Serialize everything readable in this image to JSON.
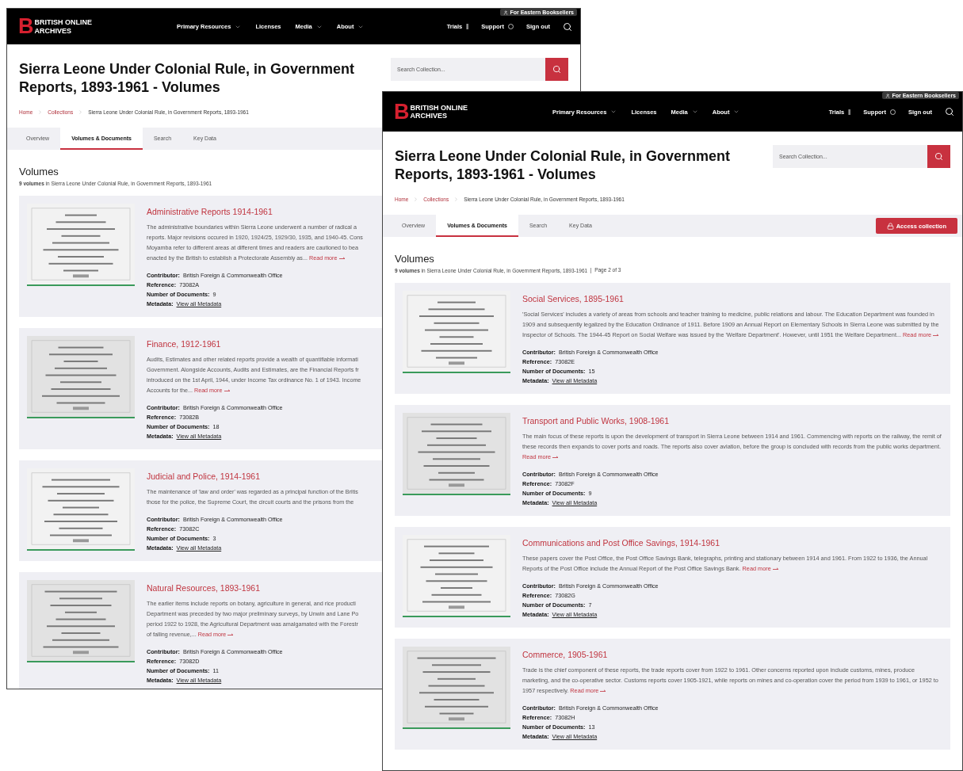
{
  "windows": [
    {
      "badge": "For Eastern Booksellers",
      "logo": {
        "mark": "B",
        "line1": "BRITISH ONLINE",
        "line2": "ARCHIVES"
      },
      "nav": [
        {
          "label": "Primary Resources",
          "dropdown": true
        },
        {
          "label": "Licenses",
          "dropdown": false
        },
        {
          "label": "Media",
          "dropdown": true
        },
        {
          "label": "About",
          "dropdown": true
        }
      ],
      "user_links": [
        {
          "label": "Trials",
          "kind": "trials"
        },
        {
          "label": "Support",
          "kind": "support"
        },
        {
          "label": "Sign out",
          "kind": "plain"
        }
      ],
      "title": "Sierra Leone Under Colonial Rule, in Government Reports, 1893-1961 - Volumes",
      "search": {
        "placeholder": "Search Collection..."
      },
      "breadcrumb": [
        "Home",
        "Collections",
        "Sierra Leone Under Colonial Rule, in Government Reports, 1893-1961"
      ],
      "tabs": [
        {
          "label": "Overview",
          "selected": false
        },
        {
          "label": "Volumes & Documents",
          "selected": true
        },
        {
          "label": "Search",
          "selected": false
        },
        {
          "label": "Key Data",
          "selected": false
        }
      ],
      "heading": "Volumes",
      "count": "**9 volumes** in Sierra Leone Under Colonial Rule, in Government Reports, 1893-1961",
      "cards": [
        {
          "title": "Administrative Reports 1914-1961",
          "lines": [
            "The administrative boundaries within Sierra Leone underwent a number of radical a",
            "reports. Major revisions occured in 1920, 1924/25, 1929/30, 1935, and 1940-45. Cons",
            "Moyamba refer to different areas at different times and readers are cautioned to bea",
            "enacted by the British to establish a Protectorate Assembly as..."
          ],
          "read_more": "Read more",
          "fields": [
            {
              "label": "Contributor:",
              "value": "British Foreign & Commonwealth Office",
              "kind": "text"
            },
            {
              "label": "Reference:",
              "value": "73082A",
              "kind": "text"
            },
            {
              "label": "Number of Documents:",
              "value": "9",
              "kind": "text"
            },
            {
              "label": "Metadata:",
              "value": "View all Metadata",
              "kind": "link"
            }
          ]
        },
        {
          "title": "Finance, 1912-1961",
          "lines": [
            "Audits, Estimates and other related reports provide a wealth of quantifiable informati",
            "Government. Alongside Accounts, Audits and Estimates, are the Financial Reports fr",
            "introduced on the 1st April, 1944, under Income Tax ordinance No. 1 of 1943. Income",
            "Accounts for the..."
          ],
          "read_more": "Read more",
          "fields": [
            {
              "label": "Contributor:",
              "value": "British Foreign & Commonwealth Office",
              "kind": "text"
            },
            {
              "label": "Reference:",
              "value": "73082B",
              "kind": "text"
            },
            {
              "label": "Number of Documents:",
              "value": "18",
              "kind": "text"
            },
            {
              "label": "Metadata:",
              "value": "View all Metadata",
              "kind": "link"
            }
          ]
        },
        {
          "title": "Judicial and Police, 1914-1961",
          "lines": [
            "The maintenance of 'law and order' was regarded as a principal function of the Britis",
            "those for the police, the Supreme Court, the circuit courts and the prisons from the"
          ],
          "fields": [
            {
              "label": "Contributor:",
              "value": "British Foreign & Commonwealth Office",
              "kind": "text"
            },
            {
              "label": "Reference:",
              "value": "73082C",
              "kind": "text"
            },
            {
              "label": "Number of Documents:",
              "value": "3",
              "kind": "text"
            },
            {
              "label": "Metadata:",
              "value": "View all Metadata",
              "kind": "link"
            }
          ]
        },
        {
          "title": "Natural Resources, 1893-1961",
          "lines": [
            "The earlier items include reports on botany, agriculture in general, and rice producti",
            "Department was preceded by two major preliminary surveys, by Unwin and Lane Po",
            "period 1922 to 1928, the Agricultural Department was amalgamated with the Forestr",
            "of falling revenue,..."
          ],
          "read_more": "Read more",
          "fields": [
            {
              "label": "Contributor:",
              "value": "British Foreign & Commonwealth Office",
              "kind": "text"
            },
            {
              "label": "Reference:",
              "value": "73082D",
              "kind": "text"
            },
            {
              "label": "Number of Documents:",
              "value": "11",
              "kind": "text"
            },
            {
              "label": "Metadata:",
              "value": "View all Metadata",
              "kind": "link"
            }
          ]
        }
      ]
    },
    {
      "badge": "For Eastern Booksellers",
      "logo": {
        "mark": "B",
        "line1": "BRITISH ONLINE",
        "line2": "ARCHIVES"
      },
      "nav": [
        {
          "label": "Primary Resources",
          "dropdown": true
        },
        {
          "label": "Licenses",
          "dropdown": false
        },
        {
          "label": "Media",
          "dropdown": true
        },
        {
          "label": "About",
          "dropdown": true
        }
      ],
      "user_links": [
        {
          "label": "Trials",
          "kind": "trials"
        },
        {
          "label": "Support",
          "kind": "support"
        },
        {
          "label": "Sign out",
          "kind": "plain"
        }
      ],
      "title": "Sierra Leone Under Colonial Rule, in Government Reports, 1893-1961 - Volumes",
      "search": {
        "placeholder": "Search Collection..."
      },
      "breadcrumb": [
        "Home",
        "Collections",
        "Sierra Leone Under Colonial Rule, in Government Reports, 1893-1961"
      ],
      "tabs": [
        {
          "label": "Overview",
          "selected": false
        },
        {
          "label": "Volumes & Documents",
          "selected": true
        },
        {
          "label": "Search",
          "selected": false
        },
        {
          "label": "Key Data",
          "selected": false
        }
      ],
      "access_button": "Access collection",
      "heading": "Volumes",
      "count": "**9 volumes** in Sierra Leone Under Colonial Rule, in Government Reports, 1893-1961",
      "page": "Page 2 of 3",
      "cards": [
        {
          "title": "Social Services, 1895-1961",
          "description": "'Social Services' includes a variety of areas from schools and teacher training to medicine, public relations and labour. The Education Department was founded in 1909 and subsequently legalized by the Education Ordinance of 1911. Before 1909 an Annual Report on Elementary Schools in Sierra Leone was submitted by the Inspector of Schools. The 1944-45 Report on Social Welfare was issued by the 'Welfare Department'. However, until 1951 the Welfare Department...",
          "read_more": "Read more",
          "fields": [
            {
              "label": "Contributor:",
              "value": "British Foreign & Commonwealth Office",
              "kind": "text"
            },
            {
              "label": "Reference:",
              "value": "73082E",
              "kind": "text"
            },
            {
              "label": "Number of Documents:",
              "value": "15",
              "kind": "text"
            },
            {
              "label": "Metadata:",
              "value": "View all Metadata",
              "kind": "link"
            }
          ]
        },
        {
          "title": "Transport and Public Works, 1908-1961",
          "description": "The main focus of these reports is upon the development of transport in Sierra Leone between 1914 and 1961. Commencing with reports on the railway, the remit of these records then expands to cover ports and roads. The reports also cover aviation, before the group is concluded with records from the public works department.",
          "read_more": "Read more",
          "fields": [
            {
              "label": "Contributor:",
              "value": "British Foreign & Commonwealth Office",
              "kind": "text"
            },
            {
              "label": "Reference:",
              "value": "73082F",
              "kind": "text"
            },
            {
              "label": "Number of Documents:",
              "value": "9",
              "kind": "text"
            },
            {
              "label": "Metadata:",
              "value": "View all Metadata",
              "kind": "link"
            }
          ]
        },
        {
          "title": "Communications and Post Office Savings, 1914-1961",
          "description": "These papers cover the Post Office, the Post Office Savings Bank, telegraphs, printing and stationary between 1914 and 1961. From 1922 to 1936, the Annual Reports of the Post Office include the Annual Report of the Post Office Savings Bank.",
          "read_more": "Read more",
          "fields": [
            {
              "label": "Contributor:",
              "value": "British Foreign & Commonwealth Office",
              "kind": "text"
            },
            {
              "label": "Reference:",
              "value": "73082G",
              "kind": "text"
            },
            {
              "label": "Number of Documents:",
              "value": "7",
              "kind": "text"
            },
            {
              "label": "Metadata:",
              "value": "View all Metadata",
              "kind": "link"
            }
          ]
        },
        {
          "title": "Commerce, 1905-1961",
          "description": "Trade is the chief component of these reports, the trade reports cover from 1922 to 1961. Other concerns reported upon include customs, mines, produce marketing, and the co-operative sector. Customs reports cover 1905-1921, while reports on mines and co-operation cover the period from 1939 to 1961, or 1952 to 1957 respectively.",
          "read_more": "Read more",
          "fields": [
            {
              "label": "Contributor:",
              "value": "British Foreign & Commonwealth Office",
              "kind": "text"
            },
            {
              "label": "Reference:",
              "value": "73082H",
              "kind": "text"
            },
            {
              "label": "Number of Documents:",
              "value": "13",
              "kind": "text"
            },
            {
              "label": "Metadata:",
              "value": "View all Metadata",
              "kind": "link"
            }
          ]
        }
      ]
    }
  ]
}
